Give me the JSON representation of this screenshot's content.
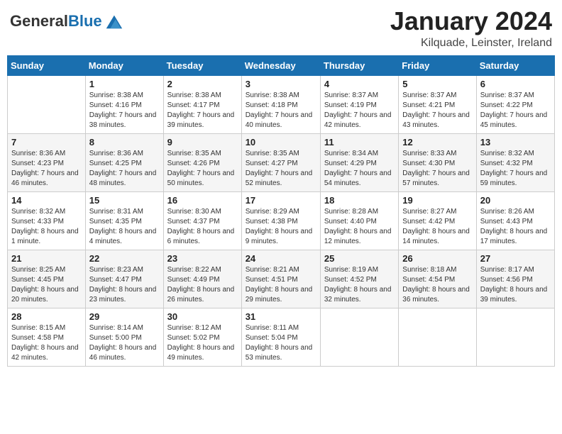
{
  "header": {
    "logo_general": "General",
    "logo_blue": "Blue",
    "month_title": "January 2024",
    "location": "Kilquade, Leinster, Ireland"
  },
  "weekdays": [
    "Sunday",
    "Monday",
    "Tuesday",
    "Wednesday",
    "Thursday",
    "Friday",
    "Saturday"
  ],
  "weeks": [
    [
      {
        "day": "",
        "sunrise": "",
        "sunset": "",
        "daylight": ""
      },
      {
        "day": "1",
        "sunrise": "Sunrise: 8:38 AM",
        "sunset": "Sunset: 4:16 PM",
        "daylight": "Daylight: 7 hours and 38 minutes."
      },
      {
        "day": "2",
        "sunrise": "Sunrise: 8:38 AM",
        "sunset": "Sunset: 4:17 PM",
        "daylight": "Daylight: 7 hours and 39 minutes."
      },
      {
        "day": "3",
        "sunrise": "Sunrise: 8:38 AM",
        "sunset": "Sunset: 4:18 PM",
        "daylight": "Daylight: 7 hours and 40 minutes."
      },
      {
        "day": "4",
        "sunrise": "Sunrise: 8:37 AM",
        "sunset": "Sunset: 4:19 PM",
        "daylight": "Daylight: 7 hours and 42 minutes."
      },
      {
        "day": "5",
        "sunrise": "Sunrise: 8:37 AM",
        "sunset": "Sunset: 4:21 PM",
        "daylight": "Daylight: 7 hours and 43 minutes."
      },
      {
        "day": "6",
        "sunrise": "Sunrise: 8:37 AM",
        "sunset": "Sunset: 4:22 PM",
        "daylight": "Daylight: 7 hours and 45 minutes."
      }
    ],
    [
      {
        "day": "7",
        "sunrise": "Sunrise: 8:36 AM",
        "sunset": "Sunset: 4:23 PM",
        "daylight": "Daylight: 7 hours and 46 minutes."
      },
      {
        "day": "8",
        "sunrise": "Sunrise: 8:36 AM",
        "sunset": "Sunset: 4:25 PM",
        "daylight": "Daylight: 7 hours and 48 minutes."
      },
      {
        "day": "9",
        "sunrise": "Sunrise: 8:35 AM",
        "sunset": "Sunset: 4:26 PM",
        "daylight": "Daylight: 7 hours and 50 minutes."
      },
      {
        "day": "10",
        "sunrise": "Sunrise: 8:35 AM",
        "sunset": "Sunset: 4:27 PM",
        "daylight": "Daylight: 7 hours and 52 minutes."
      },
      {
        "day": "11",
        "sunrise": "Sunrise: 8:34 AM",
        "sunset": "Sunset: 4:29 PM",
        "daylight": "Daylight: 7 hours and 54 minutes."
      },
      {
        "day": "12",
        "sunrise": "Sunrise: 8:33 AM",
        "sunset": "Sunset: 4:30 PM",
        "daylight": "Daylight: 7 hours and 57 minutes."
      },
      {
        "day": "13",
        "sunrise": "Sunrise: 8:32 AM",
        "sunset": "Sunset: 4:32 PM",
        "daylight": "Daylight: 7 hours and 59 minutes."
      }
    ],
    [
      {
        "day": "14",
        "sunrise": "Sunrise: 8:32 AM",
        "sunset": "Sunset: 4:33 PM",
        "daylight": "Daylight: 8 hours and 1 minute."
      },
      {
        "day": "15",
        "sunrise": "Sunrise: 8:31 AM",
        "sunset": "Sunset: 4:35 PM",
        "daylight": "Daylight: 8 hours and 4 minutes."
      },
      {
        "day": "16",
        "sunrise": "Sunrise: 8:30 AM",
        "sunset": "Sunset: 4:37 PM",
        "daylight": "Daylight: 8 hours and 6 minutes."
      },
      {
        "day": "17",
        "sunrise": "Sunrise: 8:29 AM",
        "sunset": "Sunset: 4:38 PM",
        "daylight": "Daylight: 8 hours and 9 minutes."
      },
      {
        "day": "18",
        "sunrise": "Sunrise: 8:28 AM",
        "sunset": "Sunset: 4:40 PM",
        "daylight": "Daylight: 8 hours and 12 minutes."
      },
      {
        "day": "19",
        "sunrise": "Sunrise: 8:27 AM",
        "sunset": "Sunset: 4:42 PM",
        "daylight": "Daylight: 8 hours and 14 minutes."
      },
      {
        "day": "20",
        "sunrise": "Sunrise: 8:26 AM",
        "sunset": "Sunset: 4:43 PM",
        "daylight": "Daylight: 8 hours and 17 minutes."
      }
    ],
    [
      {
        "day": "21",
        "sunrise": "Sunrise: 8:25 AM",
        "sunset": "Sunset: 4:45 PM",
        "daylight": "Daylight: 8 hours and 20 minutes."
      },
      {
        "day": "22",
        "sunrise": "Sunrise: 8:23 AM",
        "sunset": "Sunset: 4:47 PM",
        "daylight": "Daylight: 8 hours and 23 minutes."
      },
      {
        "day": "23",
        "sunrise": "Sunrise: 8:22 AM",
        "sunset": "Sunset: 4:49 PM",
        "daylight": "Daylight: 8 hours and 26 minutes."
      },
      {
        "day": "24",
        "sunrise": "Sunrise: 8:21 AM",
        "sunset": "Sunset: 4:51 PM",
        "daylight": "Daylight: 8 hours and 29 minutes."
      },
      {
        "day": "25",
        "sunrise": "Sunrise: 8:19 AM",
        "sunset": "Sunset: 4:52 PM",
        "daylight": "Daylight: 8 hours and 32 minutes."
      },
      {
        "day": "26",
        "sunrise": "Sunrise: 8:18 AM",
        "sunset": "Sunset: 4:54 PM",
        "daylight": "Daylight: 8 hours and 36 minutes."
      },
      {
        "day": "27",
        "sunrise": "Sunrise: 8:17 AM",
        "sunset": "Sunset: 4:56 PM",
        "daylight": "Daylight: 8 hours and 39 minutes."
      }
    ],
    [
      {
        "day": "28",
        "sunrise": "Sunrise: 8:15 AM",
        "sunset": "Sunset: 4:58 PM",
        "daylight": "Daylight: 8 hours and 42 minutes."
      },
      {
        "day": "29",
        "sunrise": "Sunrise: 8:14 AM",
        "sunset": "Sunset: 5:00 PM",
        "daylight": "Daylight: 8 hours and 46 minutes."
      },
      {
        "day": "30",
        "sunrise": "Sunrise: 8:12 AM",
        "sunset": "Sunset: 5:02 PM",
        "daylight": "Daylight: 8 hours and 49 minutes."
      },
      {
        "day": "31",
        "sunrise": "Sunrise: 8:11 AM",
        "sunset": "Sunset: 5:04 PM",
        "daylight": "Daylight: 8 hours and 53 minutes."
      },
      {
        "day": "",
        "sunrise": "",
        "sunset": "",
        "daylight": ""
      },
      {
        "day": "",
        "sunrise": "",
        "sunset": "",
        "daylight": ""
      },
      {
        "day": "",
        "sunrise": "",
        "sunset": "",
        "daylight": ""
      }
    ]
  ]
}
